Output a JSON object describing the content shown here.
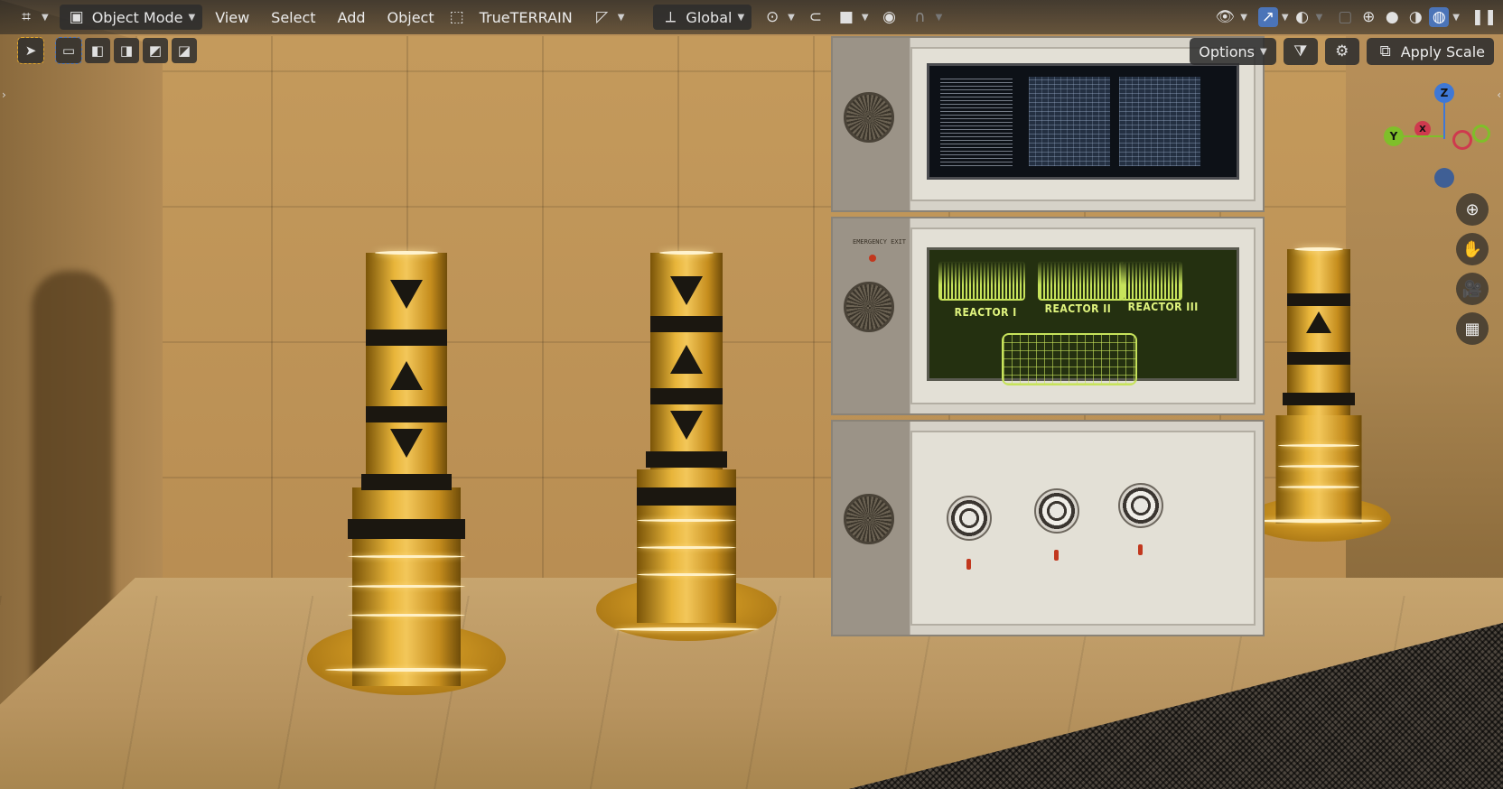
{
  "header": {
    "editor_icon": "viewport-editor-icon",
    "mode": "Object Mode",
    "menus": [
      "View",
      "Select",
      "Add",
      "Object"
    ],
    "addon": "TrueTERRAIN",
    "transform_orientation": "Global",
    "pivot_icon": "pivot-icon",
    "snap_icon": "snap-icon",
    "proportional_icon": "proportional-edit-icon",
    "falloff_icon": "falloff-curve-icon",
    "visibility_icon": "eye-icon",
    "gizmo_icon": "gizmo-icon",
    "overlay_icon": "overlay-icon",
    "xray_icon": "xray-icon",
    "shading": [
      "wireframe",
      "solid",
      "material-preview",
      "rendered"
    ],
    "active_shading": "rendered",
    "pause_icon": "pause-icon"
  },
  "toolbar": {
    "select_tool_icon": "cursor-icon",
    "select_modes": [
      "set",
      "extend",
      "subtract",
      "invert",
      "intersect"
    ]
  },
  "right_controls": {
    "options_label": "Options",
    "filter_icon": "filter-icon",
    "settings_icon": "gear-icon",
    "apply_scale_label": "Apply Scale"
  },
  "gizmo": {
    "axes": [
      "Z",
      "Y",
      "X"
    ]
  },
  "navigation": [
    "zoom-icon",
    "hand-pan-icon",
    "camera-icon",
    "grid-icon"
  ],
  "scene": {
    "reactor_labels": [
      "REACTOR I",
      "REACTOR II",
      "REACTOR III"
    ],
    "panel_text": "EMERGENCY EXIT",
    "accent_yellow": "#f0bc2c",
    "screen_green": "#c7e35b",
    "blender_blue": "#4b74b8"
  }
}
